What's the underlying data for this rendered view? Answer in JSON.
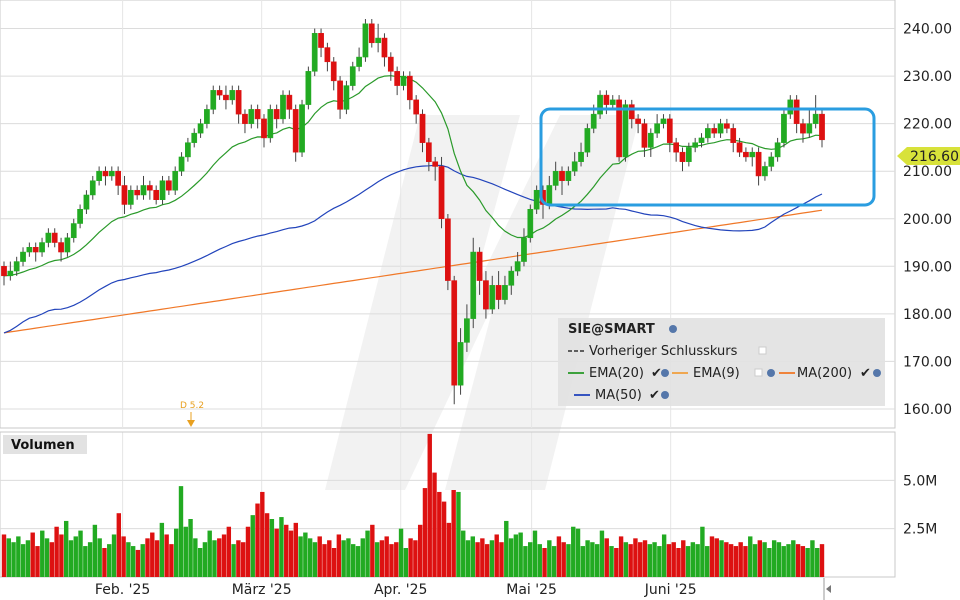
{
  "chart_data": {
    "type": "candlestick",
    "symbol_label": "SIE@SMART",
    "last_price": "216.60",
    "x_labels": [
      "Feb. '25",
      "März '25",
      "Apr. '25",
      "Mai '25",
      "Juni '25"
    ],
    "price_axis": {
      "ticks": [
        "160.00",
        "170.00",
        "180.00",
        "190.00",
        "200.00",
        "210.00",
        "220.00",
        "230.00",
        "240.00"
      ],
      "ylim": [
        156,
        246
      ]
    },
    "volume_axis": {
      "title": "Volumen",
      "ticks": [
        "2.5M",
        "5.0M"
      ],
      "ylim": [
        0,
        7500000
      ]
    },
    "legend": {
      "items": [
        "Vorheriger Schlusskurs",
        "EMA(20)",
        "EMA(9)",
        "MA(200)",
        "MA(50)"
      ]
    },
    "annotation": "D 5.2",
    "colors": {
      "up": "#22aa22",
      "down": "#dd1111",
      "ema20": "#2a9a2a",
      "ema9": "#f0a040",
      "ma200": "#f07828",
      "ma50": "#2244bb",
      "highlight": "#2a9de0",
      "last_price_bg": "#d8e23a"
    },
    "candles": [
      [
        190,
        188,
        186,
        191
      ],
      [
        188,
        189,
        187,
        191
      ],
      [
        189,
        191,
        188,
        192
      ],
      [
        191,
        193,
        190,
        194
      ],
      [
        193,
        194,
        192,
        195
      ],
      [
        194,
        193,
        191,
        195
      ],
      [
        193,
        195,
        192,
        196
      ],
      [
        195,
        197,
        194,
        198
      ],
      [
        197,
        195,
        194,
        198
      ],
      [
        195,
        193,
        191,
        196
      ],
      [
        193,
        196,
        192,
        197
      ],
      [
        196,
        199,
        195,
        200
      ],
      [
        199,
        202,
        198,
        203
      ],
      [
        202,
        205,
        201,
        206
      ],
      [
        205,
        208,
        204,
        209
      ],
      [
        208,
        210,
        207,
        211
      ],
      [
        210,
        209,
        207,
        211
      ],
      [
        209,
        210,
        208,
        211
      ],
      [
        210,
        207,
        205,
        211
      ],
      [
        207,
        203,
        201,
        209
      ],
      [
        203,
        206,
        202,
        207
      ],
      [
        206,
        205,
        204,
        207
      ],
      [
        205,
        207,
        204,
        209
      ],
      [
        207,
        206,
        204,
        208
      ],
      [
        206,
        204,
        203,
        207
      ],
      [
        204,
        208,
        203,
        209
      ],
      [
        208,
        206,
        205,
        209
      ],
      [
        206,
        210,
        205,
        211
      ],
      [
        210,
        213,
        209,
        214
      ],
      [
        213,
        216,
        212,
        217
      ],
      [
        216,
        218,
        215,
        219
      ],
      [
        218,
        220,
        217,
        221
      ],
      [
        220,
        223,
        219,
        224
      ],
      [
        223,
        227,
        222,
        228
      ],
      [
        227,
        226,
        225,
        228
      ],
      [
        226,
        225,
        223,
        228
      ],
      [
        225,
        227,
        224,
        228
      ],
      [
        227,
        222,
        220,
        228
      ],
      [
        222,
        220,
        218,
        223
      ],
      [
        220,
        223,
        219,
        224
      ],
      [
        223,
        221,
        219,
        224
      ],
      [
        221,
        217,
        215,
        222
      ],
      [
        217,
        223,
        216,
        224
      ],
      [
        223,
        221,
        219,
        224
      ],
      [
        221,
        226,
        220,
        227
      ],
      [
        226,
        223,
        221,
        227
      ],
      [
        223,
        214,
        212,
        224
      ],
      [
        214,
        224,
        213,
        225
      ],
      [
        224,
        231,
        223,
        232
      ],
      [
        231,
        239,
        230,
        240
      ],
      [
        239,
        236,
        234,
        240
      ],
      [
        236,
        233,
        231,
        237
      ],
      [
        233,
        229,
        227,
        234
      ],
      [
        229,
        223,
        221,
        230
      ],
      [
        223,
        228,
        222,
        229
      ],
      [
        228,
        232,
        227,
        233
      ],
      [
        232,
        234,
        231,
        236
      ],
      [
        234,
        241,
        233,
        242
      ],
      [
        241,
        237,
        236,
        242
      ],
      [
        237,
        238,
        235,
        241
      ],
      [
        238,
        234,
        232,
        239
      ],
      [
        234,
        231,
        229,
        235
      ],
      [
        231,
        228,
        226,
        232
      ],
      [
        228,
        230,
        227,
        231
      ],
      [
        230,
        225,
        223,
        231
      ],
      [
        225,
        222,
        220,
        226
      ],
      [
        222,
        216,
        214,
        223
      ],
      [
        216,
        212,
        210,
        217
      ],
      [
        212,
        211,
        208,
        213
      ],
      [
        211,
        200,
        198,
        213
      ],
      [
        200,
        187,
        185,
        201
      ],
      [
        187,
        165,
        161,
        188
      ],
      [
        165,
        174,
        163,
        177
      ],
      [
        174,
        179,
        172,
        182
      ],
      [
        179,
        193,
        177,
        196
      ],
      [
        193,
        187,
        184,
        194
      ],
      [
        187,
        181,
        179,
        189
      ],
      [
        181,
        186,
        180,
        188
      ],
      [
        186,
        183,
        181,
        189
      ],
      [
        183,
        186,
        182,
        188
      ],
      [
        186,
        189,
        184,
        190
      ],
      [
        189,
        191,
        188,
        193
      ],
      [
        191,
        196,
        190,
        198
      ],
      [
        196,
        202,
        195,
        203
      ],
      [
        202,
        206,
        201,
        207
      ],
      [
        206,
        203,
        200,
        207
      ],
      [
        203,
        207,
        202,
        209
      ],
      [
        207,
        210,
        206,
        212
      ],
      [
        210,
        208,
        205,
        211
      ],
      [
        208,
        210,
        207,
        211
      ],
      [
        210,
        212,
        209,
        214
      ],
      [
        212,
        214,
        211,
        216
      ],
      [
        214,
        219,
        213,
        220
      ],
      [
        219,
        222,
        218,
        224
      ],
      [
        222,
        226,
        221,
        227
      ],
      [
        226,
        224,
        222,
        227
      ],
      [
        224,
        225,
        223,
        226
      ],
      [
        225,
        213,
        212,
        226
      ],
      [
        213,
        224,
        212,
        225
      ],
      [
        224,
        221,
        219,
        225
      ],
      [
        221,
        220,
        218,
        222
      ],
      [
        220,
        215,
        213,
        221
      ],
      [
        215,
        218,
        213,
        219
      ],
      [
        218,
        220,
        217,
        222
      ],
      [
        220,
        221,
        219,
        222
      ],
      [
        221,
        216,
        214,
        222
      ],
      [
        216,
        214,
        212,
        217
      ],
      [
        214,
        212,
        210,
        215
      ],
      [
        212,
        215,
        211,
        216
      ],
      [
        215,
        216,
        214,
        217
      ],
      [
        216,
        217,
        215,
        218
      ],
      [
        217,
        219,
        216,
        220
      ],
      [
        219,
        218,
        217,
        220
      ],
      [
        218,
        220,
        217,
        221
      ],
      [
        220,
        219,
        218,
        221
      ],
      [
        219,
        216,
        214,
        220
      ],
      [
        216,
        214,
        213,
        217
      ],
      [
        214,
        213,
        212,
        215
      ],
      [
        213,
        214,
        211,
        215
      ],
      [
        214,
        209,
        207,
        215
      ],
      [
        209,
        211,
        208,
        212
      ],
      [
        211,
        213,
        210,
        214
      ],
      [
        213,
        216,
        212,
        217
      ],
      [
        216,
        222,
        215,
        223
      ],
      [
        222,
        225,
        221,
        226
      ],
      [
        225,
        220,
        218,
        226
      ],
      [
        220,
        218,
        216,
        221
      ],
      [
        218,
        220,
        217,
        223
      ],
      [
        220,
        222,
        219,
        226
      ],
      [
        222,
        216.6,
        215,
        223
      ]
    ],
    "volumes": [
      2.2,
      2.0,
      1.8,
      2.1,
      1.7,
      1.9,
      2.3,
      1.6,
      2.4,
      2.0,
      1.8,
      2.6,
      2.2,
      2.9,
      1.9,
      2.1,
      2.4,
      1.6,
      1.8,
      2.7,
      2.0,
      1.5,
      1.7,
      2.2,
      3.3,
      2.1,
      1.8,
      1.6,
      1.4,
      1.7,
      2.0,
      2.3,
      1.9,
      2.8,
      2.2,
      1.7,
      2.5,
      4.7,
      2.6,
      3.0,
      2.0,
      1.5,
      1.8,
      2.4,
      1.9,
      2.0,
      2.2,
      2.6,
      1.7,
      1.9,
      1.8,
      2.6,
      3.2,
      3.8,
      4.4,
      3.3,
      3.0,
      2.5,
      3.1,
      2.7,
      2.4,
      2.8,
      2.1,
      2.3,
      2.0,
      1.8,
      2.1,
      1.7,
      1.9,
      1.5,
      2.2,
      1.9,
      2.0,
      1.7,
      1.6,
      2.0,
      2.4,
      2.7,
      1.8,
      1.9,
      2.1,
      1.7,
      1.8,
      2.5,
      1.5,
      2.0,
      1.9,
      2.7,
      4.6,
      7.4,
      5.4,
      4.4,
      3.9,
      2.8,
      4.5,
      4.4,
      2.4,
      1.9,
      2.1,
      1.8,
      2.0,
      1.7,
      1.9,
      2.2,
      1.8,
      2.9,
      2.0,
      2.2,
      2.3,
      1.6,
      1.8,
      2.4,
      1.7,
      1.5,
      1.9,
      1.6,
      2.1,
      1.8,
      1.7,
      2.6,
      2.5,
      1.6,
      1.9,
      1.8,
      1.7,
      2.4,
      2.0,
      1.6,
      1.5,
      2.1,
      1.8,
      1.7,
      2.0,
      1.8,
      1.9,
      1.7,
      1.8,
      1.6,
      2.2,
      1.7,
      1.8,
      1.5,
      1.9,
      1.6,
      1.8,
      1.7,
      2.6,
      1.6,
      2.1,
      2.0,
      1.9,
      1.8,
      1.7,
      1.6,
      1.8,
      1.6,
      2.1,
      1.7,
      1.9,
      1.8,
      1.5,
      1.9,
      1.8,
      1.6,
      1.7,
      1.9,
      1.7,
      1.6,
      1.5,
      1.9,
      1.5,
      1.7
    ]
  }
}
